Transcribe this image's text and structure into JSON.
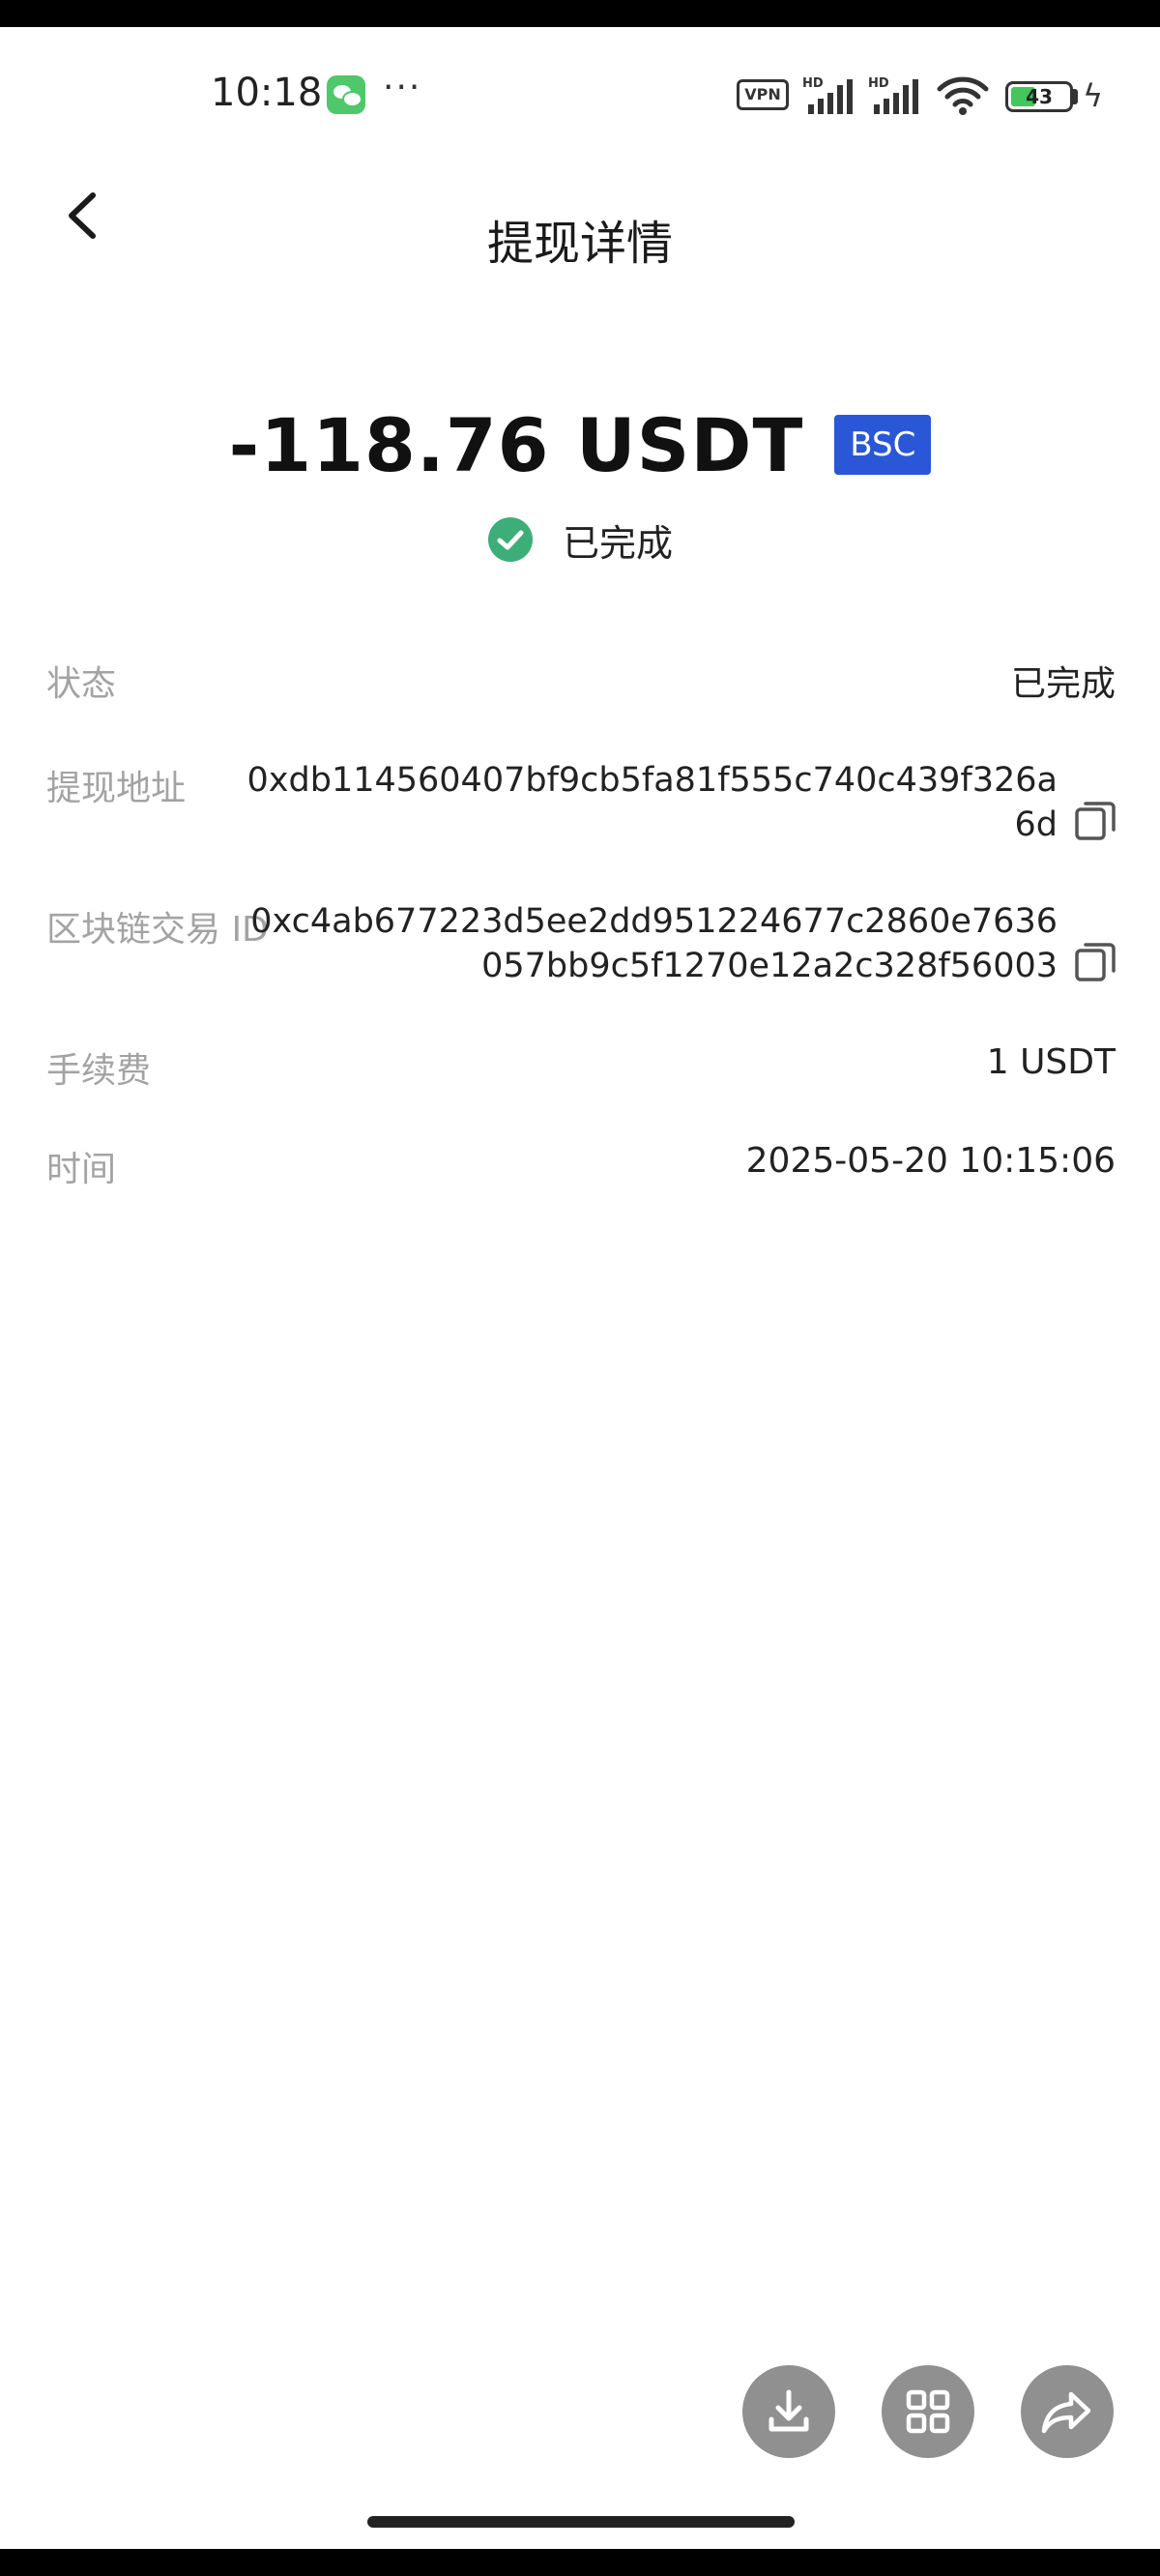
{
  "status_bar": {
    "time": "10:18",
    "vpn": "VPN",
    "battery_level": 43,
    "battery_text": "43",
    "hd_label": "HD"
  },
  "header": {
    "title": "提现详情"
  },
  "summary": {
    "amount": "-118.76 USDT",
    "chain": "BSC",
    "status": "已完成",
    "status_color": "#3dae78"
  },
  "details": {
    "status_label": "状态",
    "status_value": "已完成",
    "address_label": "提现地址",
    "address_value": "0xdb114560407bf9cb5fa81f555c740c439f326a6d",
    "txid_label": "区块链交易 ID",
    "txid_value": "0xc4ab677223d5ee2dd951224677c2860e7636057bb9c5f1270e12a2c328f56003",
    "fee_label": "手续费",
    "fee_value": "1 USDT",
    "time_label": "时间",
    "time_value": "2025-05-20 10:15:06"
  },
  "icons": {
    "back": "chevron-left-icon",
    "copy": "copy-icon",
    "download": "download-icon",
    "grid": "grid-icon",
    "share": "share-icon"
  },
  "colors": {
    "chain_badge": "#2a57d8",
    "label_gray": "#a3a3a3",
    "fab_gray": "#909090"
  }
}
